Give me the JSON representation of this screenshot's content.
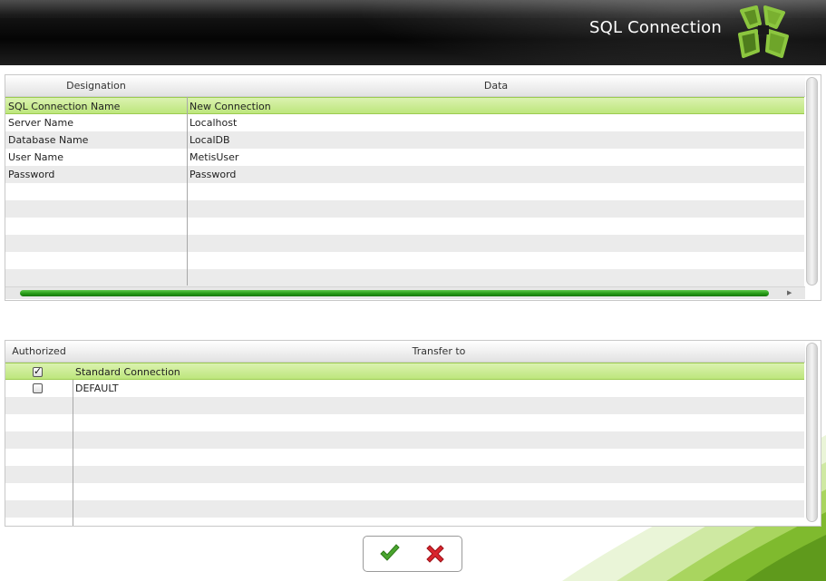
{
  "header": {
    "title": "SQL Connection"
  },
  "connection_grid": {
    "col_designation": "Designation",
    "col_data": "Data",
    "rows": [
      {
        "designation": "SQL Connection Name",
        "data": "New Connection"
      },
      {
        "designation": "Server Name",
        "data": "Localhost"
      },
      {
        "designation": "Database Name",
        "data": "LocalDB"
      },
      {
        "designation": "User Name",
        "data": "MetisUser"
      },
      {
        "designation": "Password",
        "data": "Password"
      }
    ]
  },
  "transfer_grid": {
    "col_authorized": "Authorized",
    "col_transfer": "Transfer to",
    "rows": [
      {
        "authorized": true,
        "transfer": "Standard Connection"
      },
      {
        "authorized": false,
        "transfer": "DEFAULT"
      }
    ]
  },
  "colors": {
    "accent_green": "#8cc63f",
    "selection_green": "#c8ec8a",
    "confirm": "#4aa52e",
    "cancel": "#d9262e"
  },
  "icons": {
    "confirm": "checkmark-icon",
    "cancel": "close-icon",
    "logo": "app-logo-icon"
  }
}
